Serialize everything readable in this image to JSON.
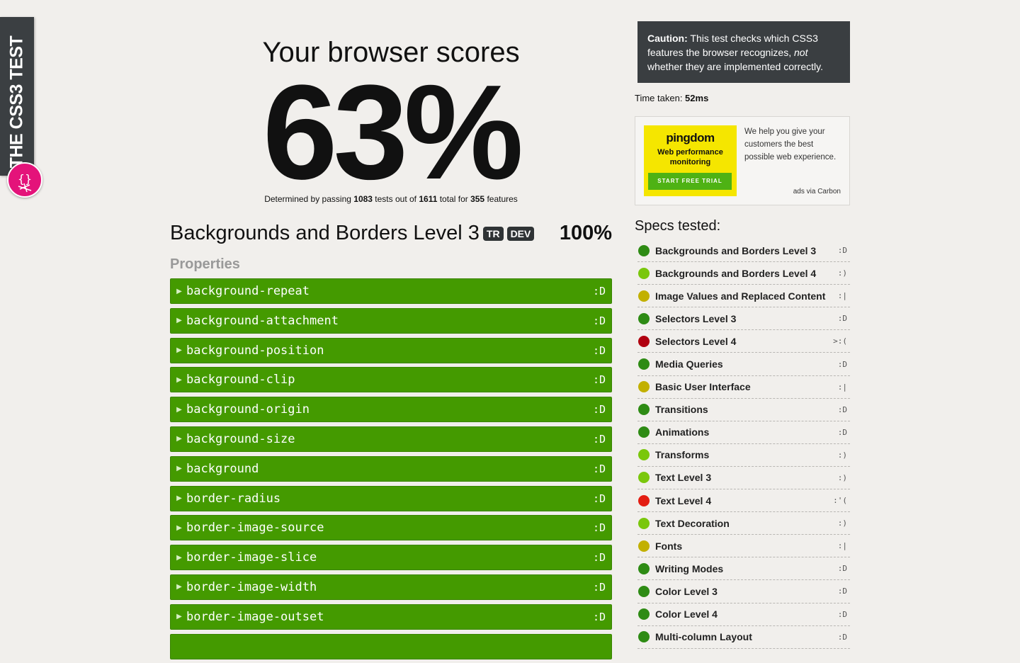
{
  "side_banner": {
    "title": "THE CSS3 TEST"
  },
  "score": {
    "heading": "Your browser scores",
    "value": "63%",
    "detail": {
      "prefix": "Determined by passing ",
      "passed": "1083",
      "middle": " tests out of ",
      "total": "1611",
      "middle2": " total for ",
      "features": "355",
      "suffix": " features"
    }
  },
  "spec": {
    "title": "Backgrounds and Borders Level 3",
    "badges": [
      "TR",
      "DEV"
    ],
    "percent": "100%",
    "section_label": "Properties",
    "properties": [
      {
        "name": "background-repeat",
        "result": ":D"
      },
      {
        "name": "background-attachment",
        "result": ":D"
      },
      {
        "name": "background-position",
        "result": ":D"
      },
      {
        "name": "background-clip",
        "result": ":D"
      },
      {
        "name": "background-origin",
        "result": ":D"
      },
      {
        "name": "background-size",
        "result": ":D"
      },
      {
        "name": "background",
        "result": ":D"
      },
      {
        "name": "border-radius",
        "result": ":D"
      },
      {
        "name": "border-image-source",
        "result": ":D"
      },
      {
        "name": "border-image-slice",
        "result": ":D"
      },
      {
        "name": "border-image-width",
        "result": ":D"
      },
      {
        "name": "border-image-outset",
        "result": ":D"
      },
      {
        "name": "",
        "result": ""
      }
    ]
  },
  "caution": {
    "label": "Caution:",
    "text1": " This test checks which CSS3 features the browser recognizes, ",
    "emph": "not",
    "text2": " whether they are implemented correctly."
  },
  "time_taken": {
    "label": "Time taken: ",
    "value": "52ms"
  },
  "ad": {
    "brand": "pingdom",
    "tagline": "Web performance monitoring",
    "cta": "START FREE TRIAL",
    "copy": "We help you give your customers the best possible web experience.",
    "via": "ads via Carbon"
  },
  "specs_tested": {
    "heading": "Specs tested:",
    "items": [
      {
        "name": "Backgrounds and Borders Level 3",
        "result": ":D",
        "color": "#2e8b14"
      },
      {
        "name": "Backgrounds and Borders Level 4",
        "result": ":)",
        "color": "#7ac70c"
      },
      {
        "name": "Image Values and Replaced Content",
        "result": ":|",
        "color": "#c2b000"
      },
      {
        "name": "Selectors Level 3",
        "result": ":D",
        "color": "#2e8b14"
      },
      {
        "name": "Selectors Level 4",
        "result": ">:(",
        "color": "#b0000f"
      },
      {
        "name": "Media Queries",
        "result": ":D",
        "color": "#2e8b14"
      },
      {
        "name": "Basic User Interface",
        "result": ":|",
        "color": "#c2b000"
      },
      {
        "name": "Transitions",
        "result": ":D",
        "color": "#2e8b14"
      },
      {
        "name": "Animations",
        "result": ":D",
        "color": "#2e8b14"
      },
      {
        "name": "Transforms",
        "result": ":)",
        "color": "#7ac70c"
      },
      {
        "name": "Text Level 3",
        "result": ":)",
        "color": "#7ac70c"
      },
      {
        "name": "Text Level 4",
        "result": ":'(",
        "color": "#e31d12"
      },
      {
        "name": "Text Decoration",
        "result": ":)",
        "color": "#7ac70c"
      },
      {
        "name": "Fonts",
        "result": ":|",
        "color": "#c2b000"
      },
      {
        "name": "Writing Modes",
        "result": ":D",
        "color": "#2e8b14"
      },
      {
        "name": "Color Level 3",
        "result": ":D",
        "color": "#2e8b14"
      },
      {
        "name": "Color Level 4",
        "result": ":D",
        "color": "#2e8b14"
      },
      {
        "name": "Multi-column Layout",
        "result": ":D",
        "color": "#2e8b14"
      }
    ]
  }
}
